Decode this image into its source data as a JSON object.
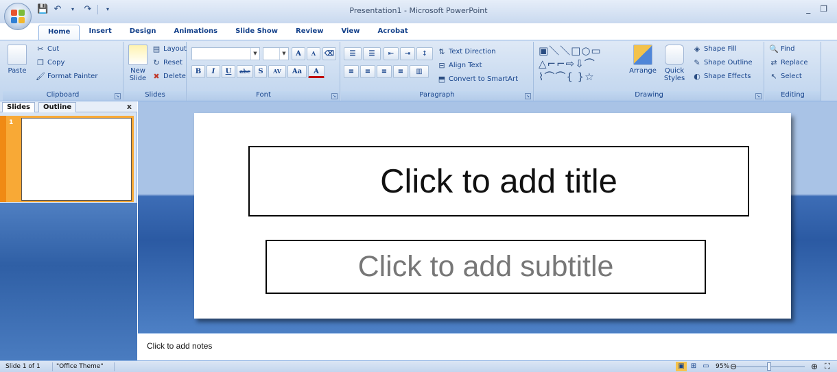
{
  "window": {
    "title": "Presentation1 - Microsoft PowerPoint",
    "controls": [
      "_",
      "❐",
      "✕"
    ]
  },
  "tabs": [
    "Home",
    "Insert",
    "Design",
    "Animations",
    "Slide Show",
    "Review",
    "View",
    "Acrobat"
  ],
  "ribbon": {
    "clipboard": {
      "paste": "Paste",
      "cut": "Cut",
      "copy": "Copy",
      "format_painter": "Format Painter",
      "label": "Clipboard"
    },
    "slides": {
      "new_slide": "New Slide",
      "layout": "Layout",
      "reset": "Reset",
      "delete": "Delete",
      "label": "Slides"
    },
    "font": {
      "grow": "A",
      "shrink": "A",
      "bold": "B",
      "italic": "I",
      "underline": "U",
      "strike": "abc",
      "shadow": "S",
      "spacing": "AV",
      "case": "Aa",
      "color": "A",
      "label": "Font"
    },
    "paragraph": {
      "text_direction": "Text Direction",
      "align_text": "Align Text",
      "convert_smartart": "Convert to SmartArt",
      "label": "Paragraph"
    },
    "drawing": {
      "arrange": "Arrange",
      "quick_styles": "Quick Styles",
      "shape_fill": "Shape Fill",
      "shape_outline": "Shape Outline",
      "shape_effects": "Shape Effects",
      "label": "Drawing"
    },
    "editing": {
      "find": "Find",
      "replace": "Replace",
      "select": "Select",
      "label": "Editing"
    }
  },
  "left_panel": {
    "tab_slides": "Slides",
    "tab_outline": "Outline",
    "close": "x",
    "thumb_number": "1"
  },
  "slide": {
    "title_placeholder": "Click to add title",
    "subtitle_placeholder": "Click to add subtitle"
  },
  "notes": {
    "placeholder": "Click to add notes"
  },
  "status": {
    "slide_info": "Slide 1 of 1",
    "theme": "\"Office Theme\"",
    "zoom": "95%",
    "zoom_level": 0.48
  },
  "colors": {
    "ribbon": "#c8daf0",
    "accent_orange": "#f8a936",
    "text_blue": "#15428b"
  }
}
